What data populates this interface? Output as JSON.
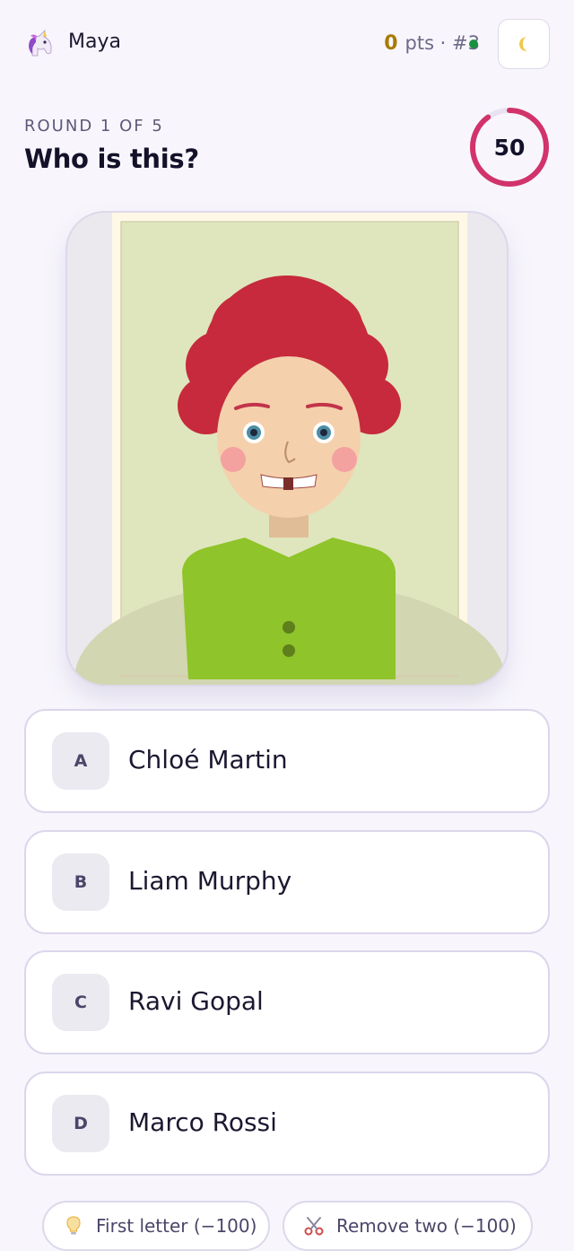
{
  "header": {
    "avatar_icon": "unicorn-icon",
    "username": "Maya",
    "score": "0",
    "score_unit": "pts · #3",
    "status_color": "#19923f",
    "theme_icon": "moon-icon"
  },
  "round": {
    "label": "ROUND 1 OF 5",
    "question": "Who is this?",
    "timer": "50",
    "timer_progress": 0.9,
    "timer_color": "#d1336a"
  },
  "answers": [
    {
      "letter": "A",
      "name": "Chloé Martin"
    },
    {
      "letter": "B",
      "name": "Liam Murphy"
    },
    {
      "letter": "C",
      "name": "Ravi Gopal"
    },
    {
      "letter": "D",
      "name": "Marco Rossi"
    }
  ],
  "powerups": [
    {
      "icon": "lightbulb-icon",
      "label": "First letter (−100)"
    },
    {
      "icon": "scissors-icon",
      "label": "Remove two (−100)"
    }
  ],
  "colors": {
    "hair": "#c62a3c",
    "shirt": "#8fc42a",
    "photo_background": "#dfe6bd"
  }
}
